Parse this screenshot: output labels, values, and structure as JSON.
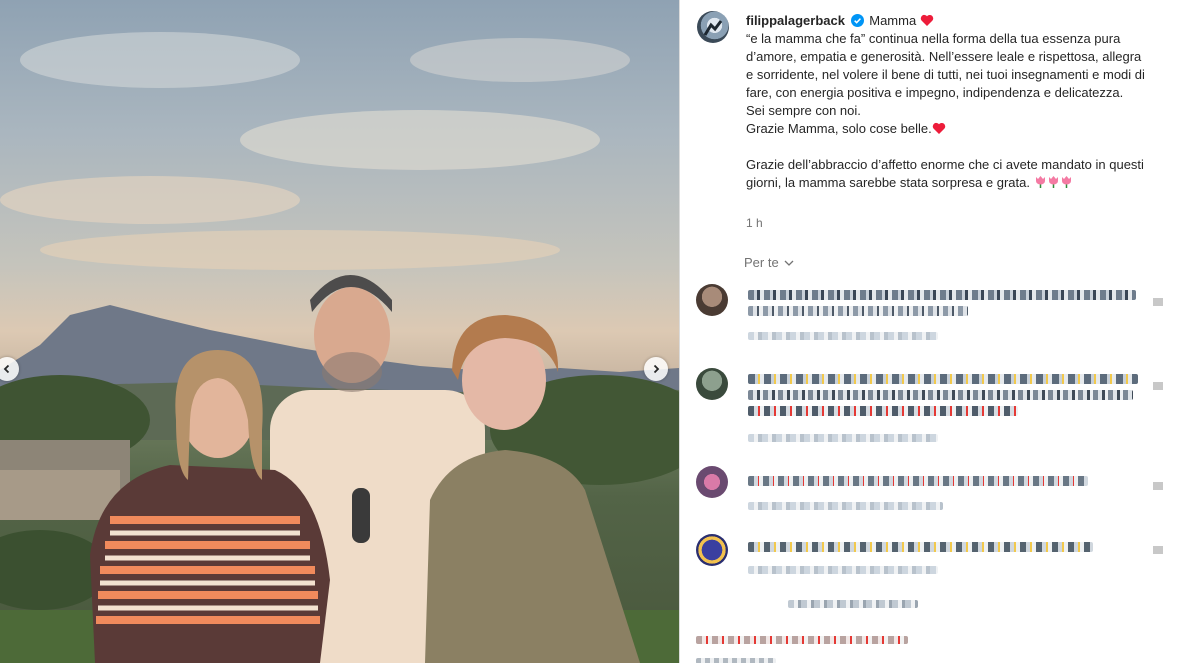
{
  "post": {
    "username": "filippalagerback",
    "caption_intro": "Mamma",
    "caption_body": "“e la mamma che fa” continua nella forma della tua essenza pura d’amore, empatia e generosità. Nell’essere leale e rispettosa, allegra e sorridente, nel volere il bene di tutti, nei tuoi insegnamenti e modi di fare, con energia positiva e impegno, indipendenza e delicatezza.\nSei sempre con noi.",
    "caption_line_thanks": "Grazie Mamma, solo cose belle.",
    "caption_closing": "Grazie dell’abbraccio d’affetto enorme che ci avete mandato in questi giorni, la mamma sarebbe stata sorpresa e grata.",
    "time": "1 h",
    "sort_label": "Per te"
  },
  "icons": {
    "verified": "verified-badge-icon",
    "heart": "red-heart-icon",
    "tulip": "tulip-icon",
    "prev": "chevron-left-icon",
    "next": "chevron-right-icon",
    "sort": "chevron-down-icon"
  },
  "colors": {
    "verified": "#0095f6",
    "heart": "#ed1c3a",
    "muted": "#737373"
  }
}
